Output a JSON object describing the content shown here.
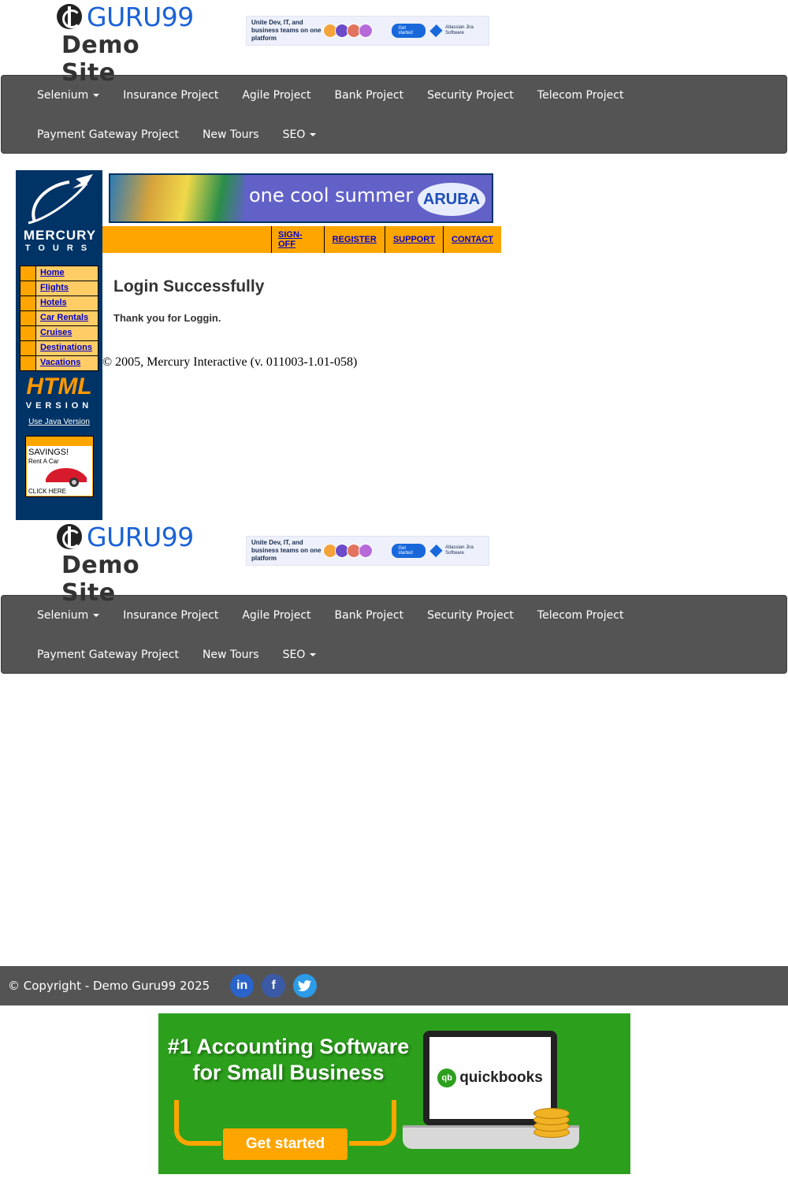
{
  "guru_header": {
    "brand": "GURU99",
    "subtitle": "Demo Site",
    "ad": {
      "text": "Unite Dev, IT, and business teams on one platform",
      "button": "Get started",
      "product": "Atlassian Jira Software"
    }
  },
  "nav": {
    "row1": [
      "Selenium",
      "Insurance Project",
      "Agile Project",
      "Bank Project",
      "Security Project",
      "Telecom Project"
    ],
    "row2": [
      "Payment Gateway Project",
      "New Tours",
      "SEO"
    ]
  },
  "mercury": {
    "logo_word1": "MERCURY",
    "logo_word2": "TOURS",
    "menu": [
      "Home",
      "Flights",
      "Hotels",
      "Car Rentals",
      "Cruises",
      "Destinations",
      "Vacations"
    ],
    "html_logo": "HTML",
    "version_text": "VERSION",
    "java_link": "Use Java Version",
    "car_ad": {
      "line1": "SAVINGS!",
      "line2": "Rent A Car",
      "line3": "CLICK HERE"
    },
    "banner": {
      "text": "one cool summer",
      "badge": "ARUBA"
    },
    "toplinks": [
      "SIGN-OFF",
      "REGISTER",
      "SUPPORT",
      "CONTACT"
    ],
    "title": "Login Successfully",
    "thanks": "Thank you for Loggin.",
    "copyright": "© 2005, Mercury Interactive (v. 011003-1.01-058)"
  },
  "footer": {
    "copyright": "© Copyright - Demo Guru99 2025",
    "social": [
      {
        "icon": "linkedin-icon",
        "glyph": "in"
      },
      {
        "icon": "facebook-icon",
        "glyph": "f"
      },
      {
        "icon": "twitter-icon",
        "glyph": "t"
      }
    ]
  },
  "qb_ad": {
    "headline_1": "#1 Accounting Software",
    "headline_2": "for Small Business",
    "button": "Get started",
    "logo_badge": "qb",
    "logo_text": "quickbooks"
  },
  "colors": {
    "nav_bg": "#545454",
    "mercury_navy": "#003366",
    "mercury_orange": "#ffa500",
    "guru_blue": "#1a62d6",
    "qb_green": "#2ca01c"
  }
}
